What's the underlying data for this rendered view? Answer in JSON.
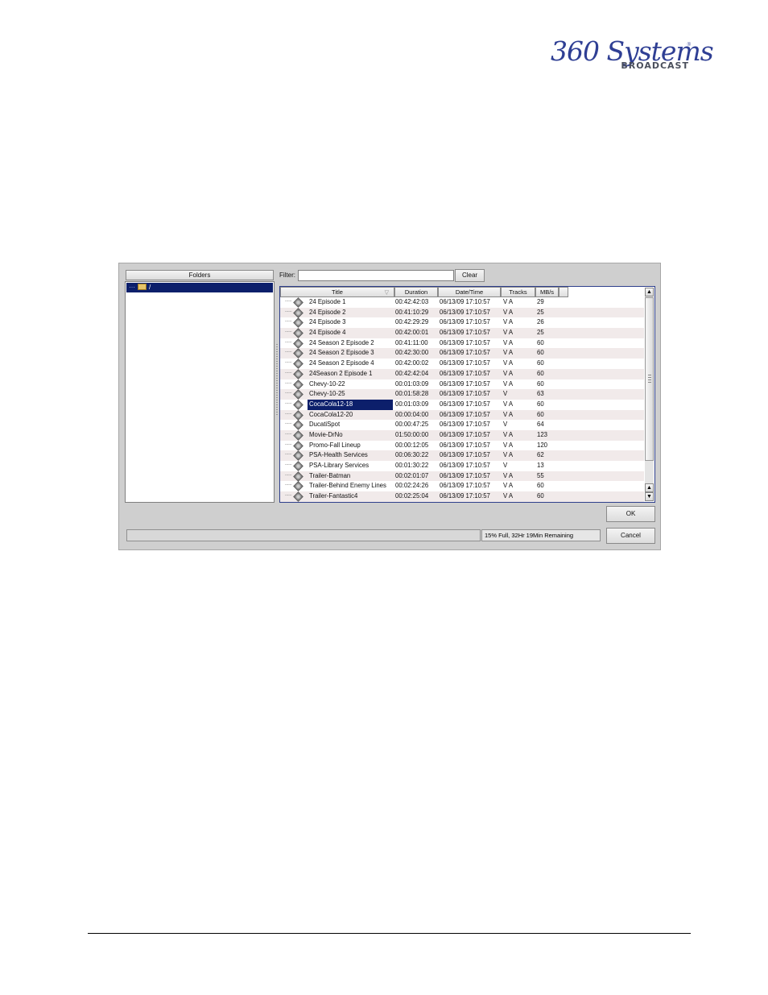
{
  "logo": {
    "wordmark": "360 Systems",
    "sub": "BROADCAST",
    "reg": "®"
  },
  "dialog": {
    "folders_header": "Folders",
    "folder_root": "/",
    "filter_label": "Filter:",
    "filter_value": "",
    "clear_label": "Clear",
    "columns": {
      "title": "Title",
      "duration": "Duration",
      "datetime": "Date/Time",
      "tracks": "Tracks",
      "mbs": "MB/s"
    },
    "rows": [
      {
        "title": "24 Episode 1",
        "duration": "00:42:42:03",
        "datetime": "06/13/09 17:10:57",
        "tracks": "V A",
        "mbs": "29"
      },
      {
        "title": "24 Episode 2",
        "duration": "00:41:10:29",
        "datetime": "06/13/09 17:10:57",
        "tracks": "V A",
        "mbs": "25"
      },
      {
        "title": "24 Episode 3",
        "duration": "00:42:29:29",
        "datetime": "06/13/09 17:10:57",
        "tracks": "V A",
        "mbs": "26"
      },
      {
        "title": "24 Episode 4",
        "duration": "00:42:00:01",
        "datetime": "06/13/09 17:10:57",
        "tracks": "V A",
        "mbs": "25"
      },
      {
        "title": "24 Season 2 Episode 2",
        "duration": "00:41:11:00",
        "datetime": "06/13/09 17:10:57",
        "tracks": "V A",
        "mbs": "60"
      },
      {
        "title": "24 Season 2 Episode 3",
        "duration": "00:42:30:00",
        "datetime": "06/13/09 17:10:57",
        "tracks": "V A",
        "mbs": "60"
      },
      {
        "title": "24 Season 2 Episode 4",
        "duration": "00:42:00:02",
        "datetime": "06/13/09 17:10:57",
        "tracks": "V A",
        "mbs": "60"
      },
      {
        "title": "24Season 2 Episode 1",
        "duration": "00:42:42:04",
        "datetime": "06/13/09 17:10:57",
        "tracks": "V A",
        "mbs": "60"
      },
      {
        "title": "Chevy-10-22",
        "duration": "00:01:03:09",
        "datetime": "06/13/09 17:10:57",
        "tracks": "V A",
        "mbs": "60"
      },
      {
        "title": "Chevy-10-25",
        "duration": "00:01:58:28",
        "datetime": "06/13/09 17:10:57",
        "tracks": "V",
        "mbs": "63"
      },
      {
        "title": "CocaCola12-18",
        "duration": "00:01:03:09",
        "datetime": "06/13/09 17:10:57",
        "tracks": "V A",
        "mbs": "60"
      },
      {
        "title": "CocaCola12-20",
        "duration": "00:00:04:00",
        "datetime": "06/13/09 17:10:57",
        "tracks": "V A",
        "mbs": "60"
      },
      {
        "title": "DucatiSpot",
        "duration": "00:00:47:25",
        "datetime": "06/13/09 17:10:57",
        "tracks": "V",
        "mbs": "64"
      },
      {
        "title": "Movie-DrNo",
        "duration": "01:50:00:00",
        "datetime": "06/13/09 17:10:57",
        "tracks": "V A",
        "mbs": "123"
      },
      {
        "title": "Promo-Fall Lineup",
        "duration": "00:00:12:05",
        "datetime": "06/13/09 17:10:57",
        "tracks": "V A",
        "mbs": "120"
      },
      {
        "title": "PSA-Health Services",
        "duration": "00:06:30:22",
        "datetime": "06/13/09 17:10:57",
        "tracks": "V A",
        "mbs": "62"
      },
      {
        "title": "PSA-Library Services",
        "duration": "00:01:30:22",
        "datetime": "06/13/09 17:10:57",
        "tracks": "V",
        "mbs": "13"
      },
      {
        "title": "Trailer-Batman",
        "duration": "00:02:01:07",
        "datetime": "06/13/09 17:10:57",
        "tracks": "V A",
        "mbs": "55"
      },
      {
        "title": "Trailer-Behind Enemy Lines",
        "duration": "00:02:24:26",
        "datetime": "06/13/09 17:10:57",
        "tracks": "V A",
        "mbs": "60"
      },
      {
        "title": "Trailer-Fantastic4",
        "duration": "00:02:25:04",
        "datetime": "06/13/09 17:10:57",
        "tracks": "V A",
        "mbs": "60"
      }
    ],
    "selected_index": 10,
    "ok_label": "OK",
    "cancel_label": "Cancel",
    "status": "15% Full, 32Hr 19Min Remaining",
    "colors": {
      "selection": "#0c1f6b",
      "alt_row": "#f1eaea"
    }
  }
}
